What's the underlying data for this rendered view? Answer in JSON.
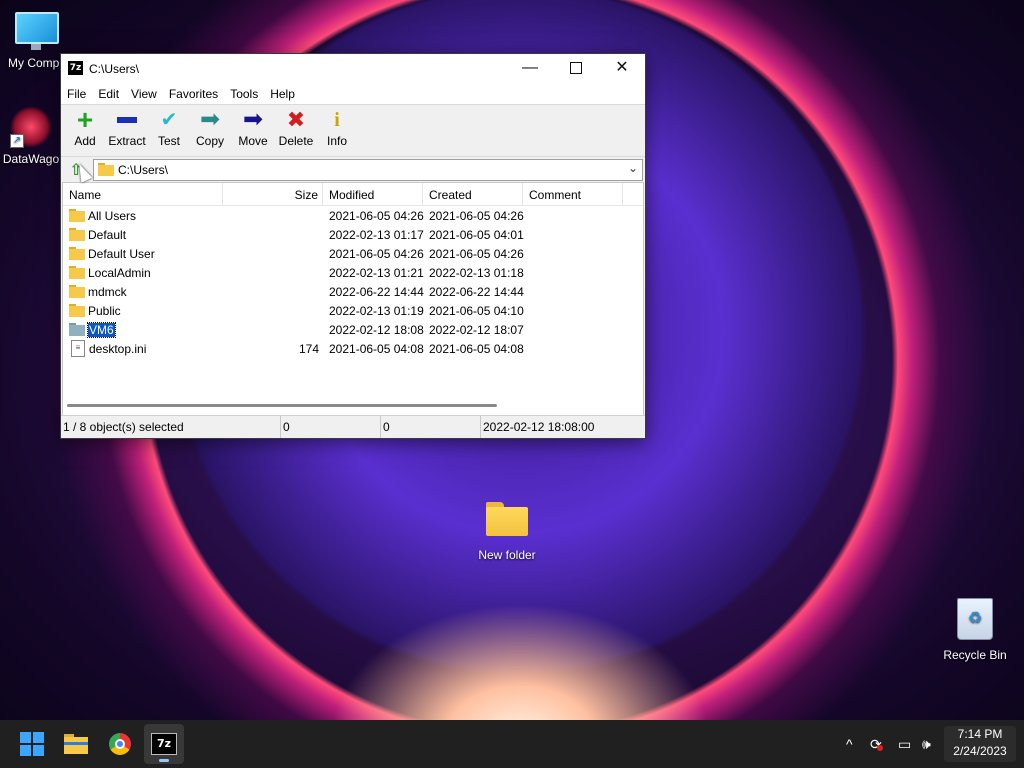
{
  "desktop": {
    "icons": [
      {
        "label": "My Compu"
      },
      {
        "label": "DataWago"
      },
      {
        "label": "New folder"
      },
      {
        "label": "Recycle Bin"
      }
    ]
  },
  "window": {
    "title": "C:\\Users\\",
    "app_icon_text": "7z",
    "controls": {
      "minimize": "—",
      "close": "✕"
    },
    "menu": [
      "File",
      "Edit",
      "View",
      "Favorites",
      "Tools",
      "Help"
    ],
    "toolbar": [
      {
        "label": "Add",
        "icon": "plus-icon",
        "color": "#1fa31f"
      },
      {
        "label": "Extract",
        "icon": "minus-icon",
        "color": "#1a2fb8"
      },
      {
        "label": "Test",
        "icon": "check-icon",
        "color": "#2ab8c8"
      },
      {
        "label": "Copy",
        "icon": "arrow-right-icon",
        "color": "#2a8a8a"
      },
      {
        "label": "Move",
        "icon": "arrow-right-icon",
        "color": "#14148c"
      },
      {
        "label": "Delete",
        "icon": "x-icon",
        "color": "#d21e1e"
      },
      {
        "label": "Info",
        "icon": "info-icon",
        "color": "#c8a800"
      }
    ],
    "address": "C:\\Users\\",
    "columns": {
      "name": "Name",
      "size": "Size",
      "modified": "Modified",
      "created": "Created",
      "comment": "Comment"
    },
    "rows": [
      {
        "name": "All Users",
        "size": "",
        "modified": "2021-06-05 04:26",
        "created": "2021-06-05 04:26",
        "type": "folder"
      },
      {
        "name": "Default",
        "size": "",
        "modified": "2022-02-13 01:17",
        "created": "2021-06-05 04:01",
        "type": "folder"
      },
      {
        "name": "Default User",
        "size": "",
        "modified": "2021-06-05 04:26",
        "created": "2021-06-05 04:26",
        "type": "folder"
      },
      {
        "name": "LocalAdmin",
        "size": "",
        "modified": "2022-02-13 01:21",
        "created": "2022-02-13 01:18",
        "type": "folder"
      },
      {
        "name": "mdmck",
        "size": "",
        "modified": "2022-06-22 14:44",
        "created": "2022-06-22 14:44",
        "type": "folder"
      },
      {
        "name": "Public",
        "size": "",
        "modified": "2022-02-13 01:19",
        "created": "2021-06-05 04:10",
        "type": "folder"
      },
      {
        "name": "VM6",
        "size": "",
        "modified": "2022-02-12 18:08",
        "created": "2022-02-12 18:07",
        "type": "folder",
        "selected": true
      },
      {
        "name": "desktop.ini",
        "size": "174",
        "modified": "2021-06-05 04:08",
        "created": "2021-06-05 04:08",
        "type": "file"
      }
    ],
    "status": {
      "selection": "1 / 8 object(s) selected",
      "size": "0",
      "packed": "0",
      "modified": "2022-02-12 18:08:00"
    }
  },
  "taskbar": {
    "time": "7:14 PM",
    "date": "2/24/2023",
    "sevenzip_label": "7z",
    "tray_chevron": "^"
  }
}
